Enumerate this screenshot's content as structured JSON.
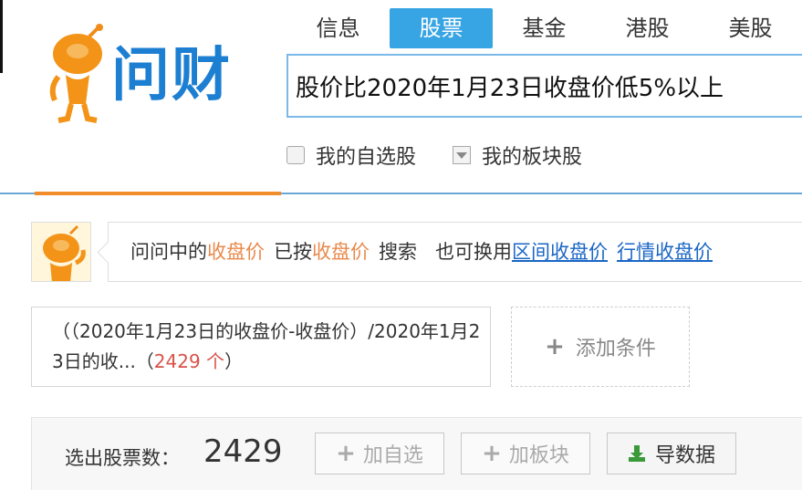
{
  "logo": {
    "text": "问财"
  },
  "tabs": [
    {
      "label": "信息",
      "active": false
    },
    {
      "label": "股票",
      "active": true
    },
    {
      "label": "基金",
      "active": false
    },
    {
      "label": "港股",
      "active": false
    },
    {
      "label": "美股",
      "active": false
    }
  ],
  "search": {
    "value": "股价比2020年1月23日收盘价低5%以上"
  },
  "options": {
    "my_watchlist": "我的自选股",
    "my_sectors": "我的板块股"
  },
  "hint": {
    "prefix": "问问中的",
    "term1": "收盘价",
    "middle": "已按",
    "term2": "收盘价",
    "suffix": "搜索",
    "alt_prefix": "也可换用",
    "link1": "区间收盘价",
    "link2": "行情收盘价"
  },
  "condition": {
    "text": "（（2020年1月23日的收盘价-收盘价）/2020年1月23日的收...（",
    "count": "2429 个",
    "close": "）"
  },
  "add_condition": {
    "label": "添加条件"
  },
  "results": {
    "count_label": "选出股票数：",
    "count_value": "2429",
    "add_watchlist": "加自选",
    "add_sector": "加板块",
    "export": "导数据"
  },
  "colors": {
    "accent": "#37a4e3",
    "brand": "#1d7fd2",
    "highlight": "#e9894b",
    "link": "#1a66c6",
    "count_red": "#d8534a"
  }
}
